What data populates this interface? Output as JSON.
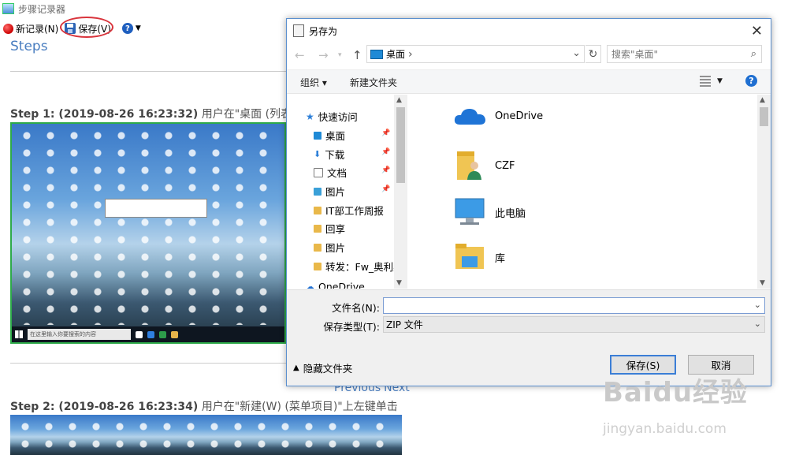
{
  "psr": {
    "window_title": "步骤记录器",
    "toolbar": {
      "new_record": "新记录(N)",
      "save": "保存(V)"
    },
    "steps_heading": "Steps",
    "steps": [
      {
        "title": "Step 1: (2019-08-26 16:23:32)",
        "desc": "用户在\"桌面 (列表)\"上"
      },
      {
        "title": "Step 2: (2019-08-26 16:23:34)",
        "desc": "用户在\"新建(W) (菜单项目)\"上左键单击"
      }
    ],
    "screenshot_taskbar_search": "在这里输入你要搜索的内容",
    "nav": {
      "previous": "Previous",
      "next": "Next"
    }
  },
  "dialog": {
    "title": "另存为",
    "address": {
      "current": "桌面",
      "separator": "›"
    },
    "search_placeholder": "搜索\"桌面\"",
    "commands": {
      "organize": "组织 ▾",
      "new_folder": "新建文件夹"
    },
    "nav_pane": [
      {
        "label": "快速访问",
        "kind": "quick-access"
      },
      {
        "label": "桌面",
        "pinned": true
      },
      {
        "label": "下载",
        "pinned": true
      },
      {
        "label": "文档",
        "pinned": true
      },
      {
        "label": "图片",
        "pinned": true
      },
      {
        "label": "IT部工作周报",
        "pinned": false
      },
      {
        "label": "回享",
        "pinned": false
      },
      {
        "label": "图片",
        "pinned": false
      },
      {
        "label": "转发：Fw_奥利奥",
        "pinned": false
      },
      {
        "label": "OneDrive",
        "kind": "onedrive"
      }
    ],
    "files": [
      "OneDrive",
      "CZF",
      "此电脑",
      "库"
    ],
    "filename_label": "文件名(N):",
    "filename_value": "",
    "filetype_label": "保存类型(T):",
    "filetype_value": "ZIP 文件",
    "hide_folders": "隐藏文件夹",
    "save_button": "保存(S)",
    "cancel_button": "取消"
  },
  "watermark": {
    "logo": "Baidu经验",
    "url": "jingyan.baidu.com"
  }
}
